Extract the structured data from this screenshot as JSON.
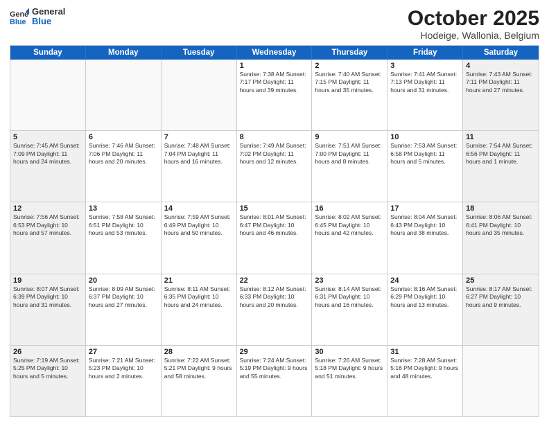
{
  "logo": {
    "general": "General",
    "blue": "Blue"
  },
  "title": "October 2025",
  "subtitle": "Hodeige, Wallonia, Belgium",
  "days_of_week": [
    "Sunday",
    "Monday",
    "Tuesday",
    "Wednesday",
    "Thursday",
    "Friday",
    "Saturday"
  ],
  "weeks": [
    [
      {
        "day": "",
        "info": "",
        "empty": true
      },
      {
        "day": "",
        "info": "",
        "empty": true
      },
      {
        "day": "",
        "info": "",
        "empty": true
      },
      {
        "day": "1",
        "info": "Sunrise: 7:38 AM\nSunset: 7:17 PM\nDaylight: 11 hours\nand 39 minutes."
      },
      {
        "day": "2",
        "info": "Sunrise: 7:40 AM\nSunset: 7:15 PM\nDaylight: 11 hours\nand 35 minutes."
      },
      {
        "day": "3",
        "info": "Sunrise: 7:41 AM\nSunset: 7:13 PM\nDaylight: 11 hours\nand 31 minutes."
      },
      {
        "day": "4",
        "info": "Sunrise: 7:43 AM\nSunset: 7:11 PM\nDaylight: 11 hours\nand 27 minutes.",
        "shaded": true
      }
    ],
    [
      {
        "day": "5",
        "info": "Sunrise: 7:45 AM\nSunset: 7:09 PM\nDaylight: 11 hours\nand 24 minutes.",
        "shaded": true
      },
      {
        "day": "6",
        "info": "Sunrise: 7:46 AM\nSunset: 7:06 PM\nDaylight: 11 hours\nand 20 minutes."
      },
      {
        "day": "7",
        "info": "Sunrise: 7:48 AM\nSunset: 7:04 PM\nDaylight: 11 hours\nand 16 minutes."
      },
      {
        "day": "8",
        "info": "Sunrise: 7:49 AM\nSunset: 7:02 PM\nDaylight: 11 hours\nand 12 minutes."
      },
      {
        "day": "9",
        "info": "Sunrise: 7:51 AM\nSunset: 7:00 PM\nDaylight: 11 hours\nand 8 minutes."
      },
      {
        "day": "10",
        "info": "Sunrise: 7:53 AM\nSunset: 6:58 PM\nDaylight: 11 hours\nand 5 minutes."
      },
      {
        "day": "11",
        "info": "Sunrise: 7:54 AM\nSunset: 6:56 PM\nDaylight: 11 hours\nand 1 minute.",
        "shaded": true
      }
    ],
    [
      {
        "day": "12",
        "info": "Sunrise: 7:56 AM\nSunset: 6:53 PM\nDaylight: 10 hours\nand 57 minutes.",
        "shaded": true
      },
      {
        "day": "13",
        "info": "Sunrise: 7:58 AM\nSunset: 6:51 PM\nDaylight: 10 hours\nand 53 minutes."
      },
      {
        "day": "14",
        "info": "Sunrise: 7:59 AM\nSunset: 6:49 PM\nDaylight: 10 hours\nand 50 minutes."
      },
      {
        "day": "15",
        "info": "Sunrise: 8:01 AM\nSunset: 6:47 PM\nDaylight: 10 hours\nand 46 minutes."
      },
      {
        "day": "16",
        "info": "Sunrise: 8:02 AM\nSunset: 6:45 PM\nDaylight: 10 hours\nand 42 minutes."
      },
      {
        "day": "17",
        "info": "Sunrise: 8:04 AM\nSunset: 6:43 PM\nDaylight: 10 hours\nand 38 minutes."
      },
      {
        "day": "18",
        "info": "Sunrise: 8:06 AM\nSunset: 6:41 PM\nDaylight: 10 hours\nand 35 minutes.",
        "shaded": true
      }
    ],
    [
      {
        "day": "19",
        "info": "Sunrise: 8:07 AM\nSunset: 6:39 PM\nDaylight: 10 hours\nand 31 minutes.",
        "shaded": true
      },
      {
        "day": "20",
        "info": "Sunrise: 8:09 AM\nSunset: 6:37 PM\nDaylight: 10 hours\nand 27 minutes."
      },
      {
        "day": "21",
        "info": "Sunrise: 8:11 AM\nSunset: 6:35 PM\nDaylight: 10 hours\nand 24 minutes."
      },
      {
        "day": "22",
        "info": "Sunrise: 8:12 AM\nSunset: 6:33 PM\nDaylight: 10 hours\nand 20 minutes."
      },
      {
        "day": "23",
        "info": "Sunrise: 8:14 AM\nSunset: 6:31 PM\nDaylight: 10 hours\nand 16 minutes."
      },
      {
        "day": "24",
        "info": "Sunrise: 8:16 AM\nSunset: 6:29 PM\nDaylight: 10 hours\nand 13 minutes."
      },
      {
        "day": "25",
        "info": "Sunrise: 8:17 AM\nSunset: 6:27 PM\nDaylight: 10 hours\nand 9 minutes.",
        "shaded": true
      }
    ],
    [
      {
        "day": "26",
        "info": "Sunrise: 7:19 AM\nSunset: 5:25 PM\nDaylight: 10 hours\nand 5 minutes.",
        "shaded": true
      },
      {
        "day": "27",
        "info": "Sunrise: 7:21 AM\nSunset: 5:23 PM\nDaylight: 10 hours\nand 2 minutes."
      },
      {
        "day": "28",
        "info": "Sunrise: 7:22 AM\nSunset: 5:21 PM\nDaylight: 9 hours\nand 58 minutes."
      },
      {
        "day": "29",
        "info": "Sunrise: 7:24 AM\nSunset: 5:19 PM\nDaylight: 9 hours\nand 55 minutes."
      },
      {
        "day": "30",
        "info": "Sunrise: 7:26 AM\nSunset: 5:18 PM\nDaylight: 9 hours\nand 51 minutes."
      },
      {
        "day": "31",
        "info": "Sunrise: 7:28 AM\nSunset: 5:16 PM\nDaylight: 9 hours\nand 48 minutes."
      },
      {
        "day": "",
        "info": "",
        "empty": true,
        "shaded": true
      }
    ]
  ]
}
